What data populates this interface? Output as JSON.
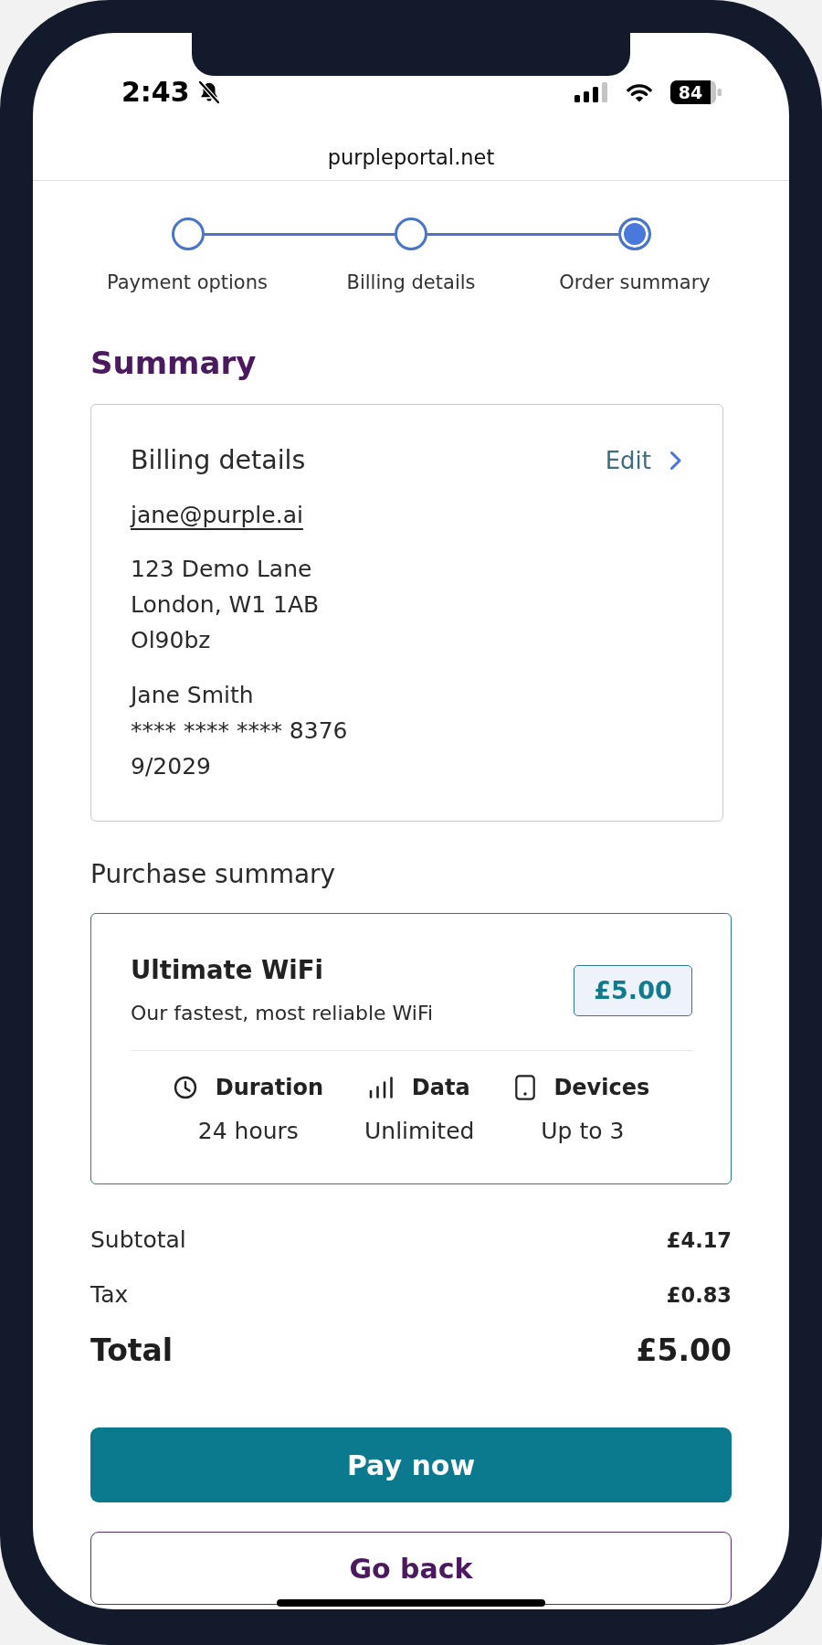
{
  "status_bar": {
    "time": "2:43",
    "battery_percentage": "84"
  },
  "address_bar": {
    "url": "purpleportal.net"
  },
  "steps": [
    {
      "label": "Payment options",
      "selected": false
    },
    {
      "label": "Billing details",
      "selected": false
    },
    {
      "label": "Order summary",
      "selected": true
    }
  ],
  "heading": "Summary",
  "billing_card": {
    "title": "Billing details",
    "edit_link": "Edit",
    "email": "jane@purple.ai",
    "address_lines": [
      "123 Demo Lane",
      "London, W1 1AB",
      "Ol90bz"
    ],
    "cardholder": "Jane Smith",
    "card_number": "**** **** **** 8376",
    "expiry": "9/2029"
  },
  "purchase_section": {
    "title": "Purchase summary",
    "product": {
      "name": "Ultimate WiFi",
      "description": "Our fastest, most reliable WiFi",
      "price": "£5.00"
    },
    "features": [
      {
        "kind": "duration",
        "label": "Duration",
        "value": "24 hours"
      },
      {
        "kind": "data",
        "label": "Data",
        "value": "Unlimited"
      },
      {
        "kind": "devices",
        "label": "Devices",
        "value": "Up to 3"
      }
    ]
  },
  "totals": [
    {
      "kind": "line",
      "label": "Subtotal",
      "value": "£4.17"
    },
    {
      "kind": "line",
      "label": "Tax",
      "value": "£0.83"
    },
    {
      "kind": "total",
      "label": "Total",
      "value": "£5.00"
    }
  ],
  "buttons": [
    {
      "kind": "primary",
      "label": "Pay now"
    },
    {
      "kind": "secondary",
      "label": "Go back"
    }
  ]
}
